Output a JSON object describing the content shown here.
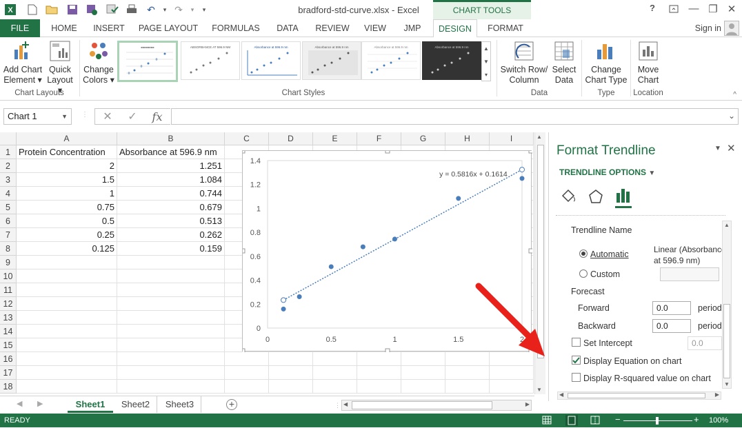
{
  "title_bar": {
    "filename": "bradford-std-curve.xlsx - Excel",
    "chart_tools": "CHART TOOLS",
    "help": "?",
    "min": "—",
    "restore": "❐",
    "close": "✕"
  },
  "tabs": [
    "FILE",
    "HOME",
    "INSERT",
    "PAGE LAYOUT",
    "FORMULAS",
    "DATA",
    "REVIEW",
    "VIEW",
    "JMP",
    "DESIGN",
    "FORMAT"
  ],
  "signin": "Sign in",
  "ribbon": {
    "add_chart_element": [
      "Add Chart",
      "Element ▾"
    ],
    "quick_layout": [
      "Quick",
      "Layout ▾"
    ],
    "change_colors": [
      "Change",
      "Colors ▾"
    ],
    "switch_row_col": [
      "Switch Row/",
      "Column"
    ],
    "select_data": [
      "Select",
      "Data"
    ],
    "change_chart_type": [
      "Change",
      "Chart Type"
    ],
    "move_chart": [
      "Move",
      "Chart"
    ],
    "groups": [
      "Chart Layouts",
      "Chart Styles",
      "Data",
      "Type",
      "Location"
    ]
  },
  "namebox": "Chart 1",
  "fx": "fx",
  "columns": [
    "A",
    "B",
    "C",
    "D",
    "E",
    "F",
    "G",
    "H",
    "I"
  ],
  "rows": [
    "1",
    "2",
    "3",
    "4",
    "5",
    "6",
    "7",
    "8",
    "9",
    "10",
    "11",
    "12",
    "13",
    "14",
    "15",
    "16",
    "17",
    "18"
  ],
  "cells": {
    "A1": "Protein Concentration",
    "B1": "Absorbance at 596.9 nm",
    "A": [
      "2",
      "1.5",
      "1",
      "0.75",
      "0.5",
      "0.25",
      "0.125"
    ],
    "B": [
      "1.251",
      "1.084",
      "0.744",
      "0.679",
      "0.513",
      "0.262",
      "0.159"
    ]
  },
  "chart_data": {
    "type": "scatter",
    "points": [
      [
        2,
        1.251
      ],
      [
        1.5,
        1.084
      ],
      [
        1,
        0.744
      ],
      [
        0.75,
        0.679
      ],
      [
        0.5,
        0.513
      ],
      [
        0.25,
        0.262
      ],
      [
        0.125,
        0.159
      ]
    ],
    "trendline": {
      "slope": 0.5816,
      "intercept": 0.1614,
      "label": "y = 0.5816x + 0.1614"
    },
    "xlim": [
      0,
      2
    ],
    "ylim": [
      0,
      1.4
    ],
    "xticks": [
      "0",
      "0.5",
      "1",
      "1.5",
      "2"
    ],
    "yticks": [
      "0",
      "0.2",
      "0.4",
      "0.6",
      "0.8",
      "1",
      "1.2",
      "1.4"
    ],
    "xticks_values": [
      0,
      0.5,
      1,
      1.5,
      2
    ],
    "yticks_values": [
      0,
      0.2,
      0.4,
      0.6,
      0.8,
      1,
      1.2,
      1.4
    ],
    "color": "#4a7ebb"
  },
  "sheets": [
    "Sheet1",
    "Sheet2",
    "Sheet3"
  ],
  "status": {
    "ready": "READY",
    "zoom": "100%"
  },
  "pane": {
    "title": "Format Trendline",
    "subtitle": "TRENDLINE OPTIONS",
    "trendline_name": "Trendline Name",
    "automatic": "Automatic",
    "automatic_value": [
      "Linear (Absorbance",
      "at 596.9 nm)"
    ],
    "custom": "Custom",
    "forecast": "Forecast",
    "forward": "Forward",
    "forward_val": "0.0",
    "backward": "Backward",
    "backward_val": "0.0",
    "periods": "period",
    "set_intercept": "Set Intercept",
    "intercept_val": "0.0",
    "display_equation": "Display Equation on chart",
    "display_r2": "Display R-squared value on chart"
  },
  "colors": {
    "excel_green": "#217346",
    "arrow_red": "#e8221b"
  }
}
